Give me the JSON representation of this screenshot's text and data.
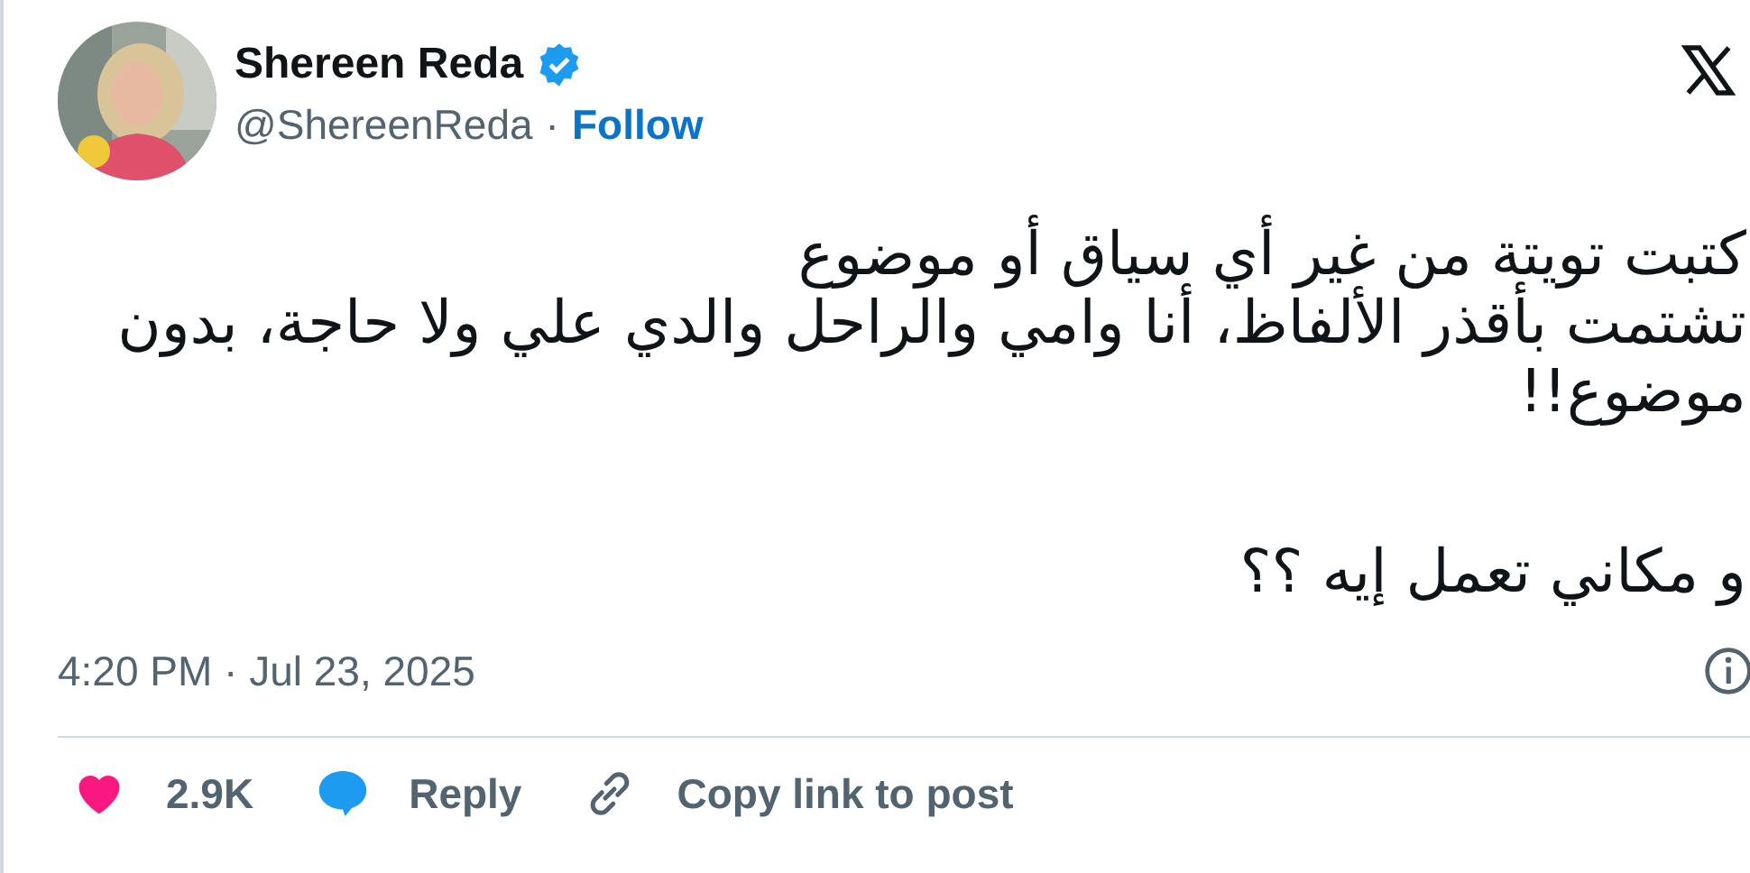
{
  "author": {
    "name": "Shereen Reda",
    "verified": true,
    "handle": "@ShereenReda",
    "separator": "·",
    "follow": "Follow"
  },
  "avatar": {
    "kind": "picture"
  },
  "paragraphs": [
    [
      "كتبت تويتة من غير أي سياق أو موضوع",
      "تشتمت بأقذر الألفاظ، أنا وامي والراحل والدي علي ولا حاجة، بدون",
      "موضوع!!"
    ],
    [
      "و مكاني تعمل إيه ؟؟"
    ]
  ],
  "timestamp": "4:20 PM · Jul 23, 2025",
  "likes": {
    "count": "2.9K"
  },
  "reply": {
    "label": "Reply"
  },
  "copy_link": {
    "label": "Copy link to post"
  }
}
